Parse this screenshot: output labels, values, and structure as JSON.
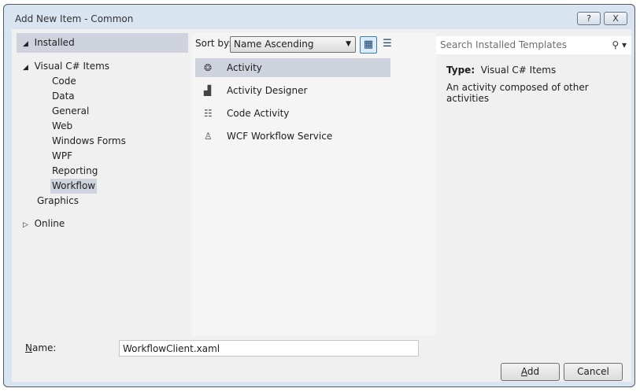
{
  "window": {
    "title": "Add New Item - Common",
    "help_label": "?",
    "close_label": "X"
  },
  "sidebar": {
    "installed": "Installed",
    "visual_csharp": "Visual C# Items",
    "children": [
      "Code",
      "Data",
      "General",
      "Web",
      "Windows Forms",
      "WPF",
      "Reporting",
      "Workflow"
    ],
    "graphics": "Graphics",
    "online": "Online"
  },
  "toolbar": {
    "sort_label": "Sort by:",
    "sort_value": "Name Ascending"
  },
  "templates": [
    {
      "label": "Activity",
      "icon": "activity-icon"
    },
    {
      "label": "Activity Designer",
      "icon": "activity-designer-icon"
    },
    {
      "label": "Code Activity",
      "icon": "code-activity-icon"
    },
    {
      "label": "WCF Workflow Service",
      "icon": "wcf-service-icon"
    }
  ],
  "search": {
    "placeholder": "Search Installed Templates"
  },
  "details": {
    "type_label": "Type:",
    "type_value": "Visual C# Items",
    "description": "An activity composed of other activities"
  },
  "form": {
    "name_label_u": "N",
    "name_label_rest": "ame:",
    "name_value": "WorkflowClient.xaml"
  },
  "buttons": {
    "add_u": "A",
    "add_rest": "dd",
    "cancel": "Cancel"
  }
}
